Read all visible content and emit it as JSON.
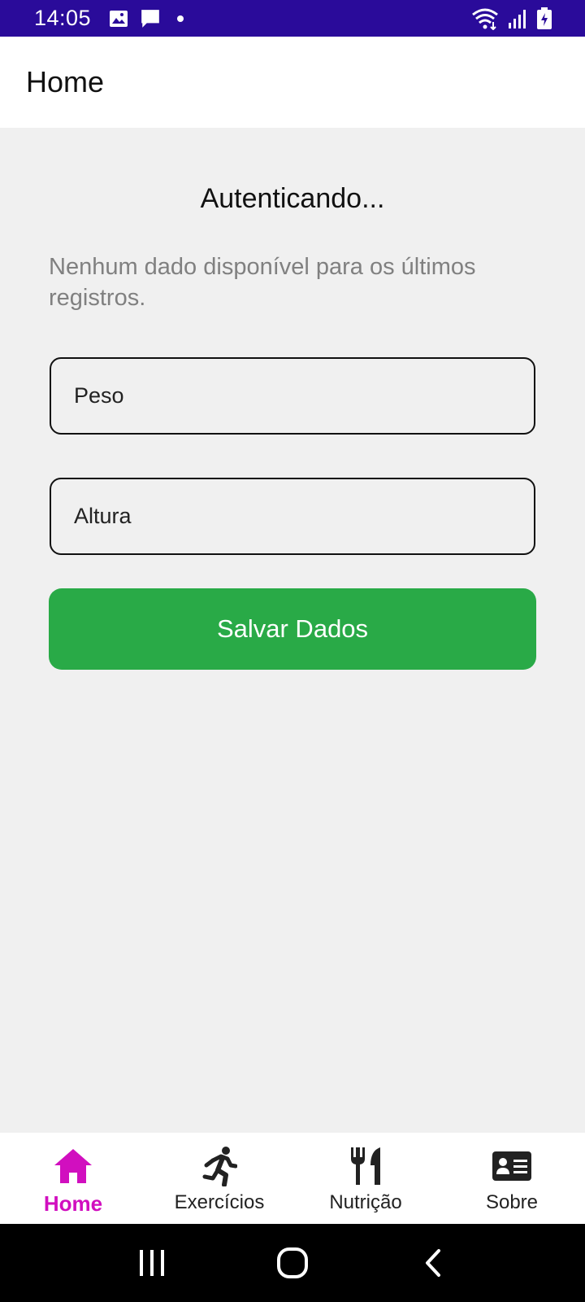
{
  "status_bar": {
    "time": "14:05",
    "left_icons": [
      "image-icon",
      "message-icon",
      "dot-icon"
    ],
    "right_icons": [
      "wifi-icon",
      "signal-icon",
      "battery-icon"
    ]
  },
  "app_bar": {
    "title": "Home"
  },
  "main": {
    "auth_status": "Autenticando...",
    "no_data_message": "Nenhum dado disponível para os últimos registros.",
    "weight_field": {
      "placeholder": "Peso",
      "value": ""
    },
    "height_field": {
      "placeholder": "Altura",
      "value": ""
    },
    "save_button_label": "Salvar Dados"
  },
  "bottom_nav": {
    "items": [
      {
        "label": "Home",
        "icon": "home-icon",
        "active": true
      },
      {
        "label": "Exercícios",
        "icon": "running-icon",
        "active": false
      },
      {
        "label": "Nutrição",
        "icon": "utensils-icon",
        "active": false
      },
      {
        "label": "Sobre",
        "icon": "id-card-icon",
        "active": false
      }
    ]
  },
  "system_nav": {
    "icons": [
      "recents-icon",
      "home-circle-icon",
      "back-icon"
    ]
  },
  "colors": {
    "status_bar": "#2a0b9a",
    "accent_active": "#d10fbf",
    "save_button": "#29aa47",
    "background": "#f0f0f0"
  }
}
